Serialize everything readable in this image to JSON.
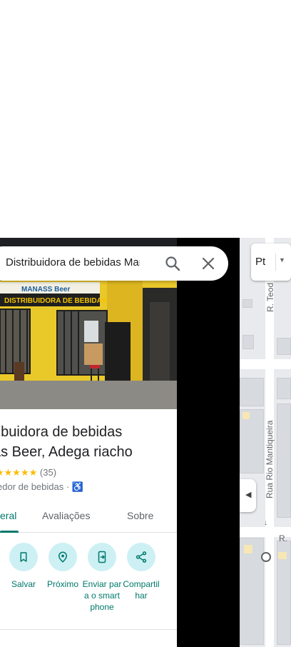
{
  "search": {
    "value": "Distribuidora de bebidas Mana"
  },
  "place": {
    "title_line1": "ribuidora de bebidas",
    "title_line2": "as Beer, Adega riacho",
    "rating_count": "(35)",
    "category": "edor de bebidas ·",
    "storefront_sign_top": "MANASS Beer",
    "storefront_sign_main": "DISTRIBUIDORA DE BEBIDAS"
  },
  "tabs": [
    {
      "label": "eral",
      "active": true
    },
    {
      "label": "Avaliações",
      "active": false
    },
    {
      "label": "Sobre",
      "active": false
    }
  ],
  "actions": [
    {
      "label": "Salvar",
      "icon": "bookmark-icon"
    },
    {
      "label": "Próximo",
      "icon": "nearby-icon"
    },
    {
      "label": "Enviar para o smartphone",
      "icon": "send-to-phone-icon"
    },
    {
      "label": "Compartilhar",
      "icon": "share-icon"
    }
  ],
  "map": {
    "layer_button": "Pt",
    "street_1": "R. Teod",
    "street_2": "Rua Rio Mantiqueira",
    "street_3": "R."
  },
  "colors": {
    "accent": "#00796b",
    "action_bg": "#cdf0f4",
    "star": "#fbbc04"
  }
}
